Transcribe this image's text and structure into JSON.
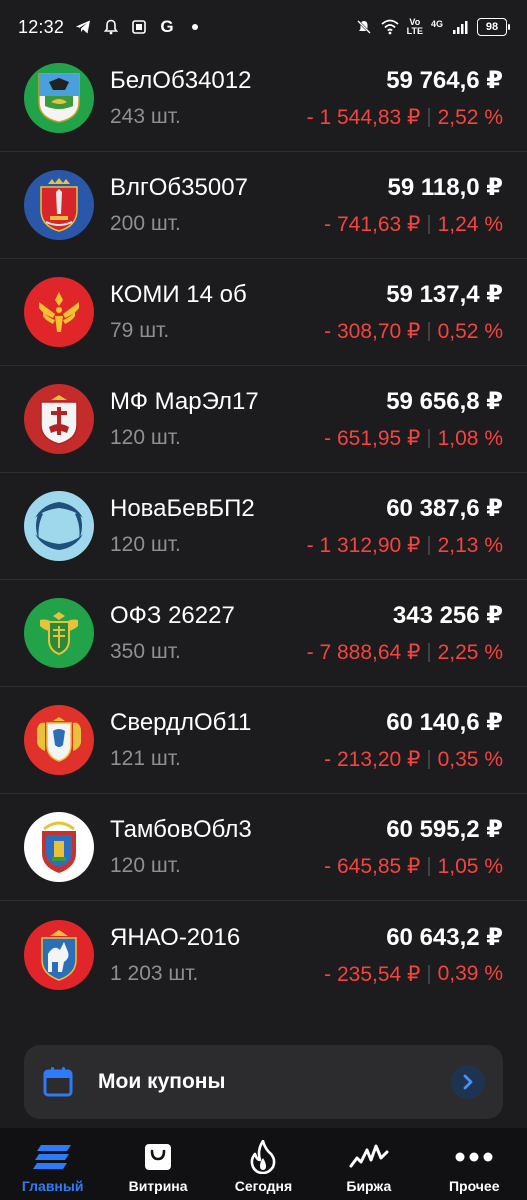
{
  "status_bar": {
    "time": "12:32",
    "network_top": "Vo",
    "network_bottom": "LTE",
    "signal_label": "4G",
    "battery": "98"
  },
  "bonds": [
    {
      "name": "БелОб34012",
      "qty": "243 шт.",
      "price": "59 764,6 ₽",
      "change": "- 1 544,83 ₽",
      "percent": "2,52 %",
      "logo": "belgorod-coat-of-arms",
      "logo_bg": "#22a34a"
    },
    {
      "name": "ВлгОб35007",
      "qty": "200 шт.",
      "price": "59 118,0 ₽",
      "change": "- 741,63 ₽",
      "percent": "1,24 %",
      "logo": "volgograd-coat-of-arms",
      "logo_bg": "#2a57a8"
    },
    {
      "name": "КОМИ 14 об",
      "qty": "79 шт.",
      "price": "59 137,4 ₽",
      "change": "- 308,70 ₽",
      "percent": "0,52 %",
      "logo": "komi-coat-of-arms",
      "logo_bg": "#e0262a"
    },
    {
      "name": "МФ МарЭл17",
      "qty": "120 шт.",
      "price": "59 656,8 ₽",
      "change": "- 651,95 ₽",
      "percent": "1,08 %",
      "logo": "mari-el-coat-of-arms",
      "logo_bg": "#c42b2b"
    },
    {
      "name": "НоваБевБП2",
      "qty": "120 шт.",
      "price": "60 387,6 ₽",
      "change": "- 1 312,90 ₽",
      "percent": "2,13 %",
      "logo": "novabev-logo",
      "logo_bg": "#9fd8ec"
    },
    {
      "name": "ОФЗ 26227",
      "qty": "350 шт.",
      "price": "343 256 ₽",
      "change": "- 7 888,64 ₽",
      "percent": "2,25 %",
      "logo": "russia-ministry-coat-of-arms",
      "logo_bg": "#22a34a"
    },
    {
      "name": "СвердлОб11",
      "qty": "121 шт.",
      "price": "60 140,6 ₽",
      "change": "- 213,20 ₽",
      "percent": "0,35 %",
      "logo": "sverdlovsk-coat-of-arms",
      "logo_bg": "#e0312a"
    },
    {
      "name": "ТамбовОбл3",
      "qty": "120 шт.",
      "price": "60 595,2 ₽",
      "change": "- 645,85 ₽",
      "percent": "1,05 %",
      "logo": "tambov-coat-of-arms",
      "logo_bg": "#ffffff"
    },
    {
      "name": "ЯНАО-2016",
      "qty": "1 203 шт.",
      "price": "60 643,2 ₽",
      "change": "- 235,54 ₽",
      "percent": "0,39 %",
      "logo": "yamal-coat-of-arms",
      "logo_bg": "#e0262a"
    }
  ],
  "coupons": {
    "label": "Мои купоны"
  },
  "nav": [
    {
      "label": "Главный",
      "icon": "home-stripes-icon",
      "active": true
    },
    {
      "label": "Витрина",
      "icon": "shopping-bag-icon",
      "active": false
    },
    {
      "label": "Сегодня",
      "icon": "flame-icon",
      "active": false
    },
    {
      "label": "Биржа",
      "icon": "chart-line-icon",
      "active": false
    },
    {
      "label": "Прочее",
      "icon": "more-dots-icon",
      "active": false
    }
  ],
  "colors": {
    "background": "#1c1c1e",
    "negative": "#f5433f",
    "accent": "#2d7bf7",
    "muted": "#8e8e93"
  }
}
